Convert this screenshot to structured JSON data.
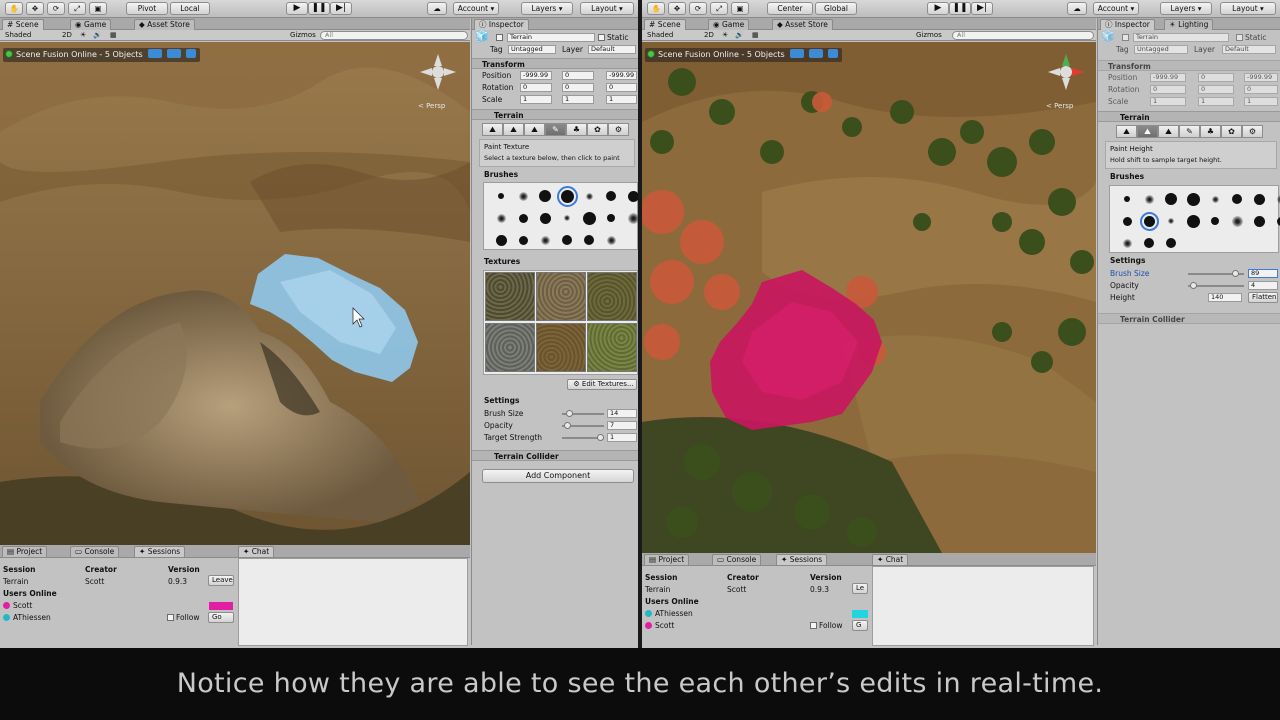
{
  "left": {
    "toolbar": {
      "pivot": "Pivot",
      "local": "Local",
      "account": "Account",
      "layers": "Layers",
      "layout": "Layout"
    },
    "tabs": {
      "scene": "Scene",
      "game": "Game",
      "asset_store": "Asset Store",
      "inspector": "Inspector"
    },
    "scene_bar": {
      "shaded": "Shaded",
      "mode_2d": "2D",
      "gizmos": "Gizmos",
      "search_placeholder": "All"
    },
    "banner": "Scene Fusion Online - 5 Objects",
    "persp": "< Persp",
    "inspector": {
      "object_name": "Terrain",
      "static": "Static",
      "tag_label": "Tag",
      "tag": "Untagged",
      "layer_label": "Layer",
      "layer": "Default",
      "transform": "Transform",
      "position": {
        "label": "Position",
        "x": "-999.99",
        "y": "0",
        "z": "-999.99"
      },
      "rotation": {
        "label": "Rotation",
        "x": "0",
        "y": "0",
        "z": "0"
      },
      "scale": {
        "label": "Scale",
        "x": "1",
        "y": "1",
        "z": "1"
      },
      "terrain": "Terrain",
      "tool_title": "Paint Texture",
      "tool_desc": "Select a texture below, then click to paint",
      "brushes": "Brushes",
      "textures": "Textures",
      "edit_textures": "Edit Textures...",
      "settings": "Settings",
      "brush_size": {
        "label": "Brush Size",
        "value": "14",
        "level": 0.12
      },
      "opacity": {
        "label": "Opacity",
        "value": "7",
        "level": 0.07
      },
      "target_strength": {
        "label": "Target Strength",
        "value": "1",
        "level": 1.0
      },
      "terrain_collider": "Terrain Collider",
      "add_component": "Add Component"
    },
    "bottom": {
      "tabs": {
        "project": "Project",
        "console": "Console",
        "sessions": "Sessions",
        "chat": "Chat"
      },
      "headers": {
        "session": "Session",
        "creator": "Creator",
        "version": "Version"
      },
      "session_row": {
        "session": "Terrain",
        "creator": "Scott",
        "version": "0.9.3",
        "leave": "Leave"
      },
      "users_online": "Users Online",
      "users": [
        {
          "name": "Scott",
          "color": "#e21ea3",
          "follow": "",
          "go": ""
        },
        {
          "name": "AThiessen",
          "color": "#22b8c8",
          "follow": "Follow",
          "go": "Go"
        }
      ]
    }
  },
  "right": {
    "toolbar": {
      "center": "Center",
      "global": "Global",
      "account": "Account",
      "layers": "Layers",
      "layout": "Layout"
    },
    "tabs": {
      "scene": "Scene",
      "game": "Game",
      "asset_store": "Asset Store",
      "inspector": "Inspector",
      "lighting": "Lighting"
    },
    "scene_bar": {
      "shaded": "Shaded",
      "mode_2d": "2D",
      "gizmos": "Gizmos",
      "search_placeholder": "All"
    },
    "banner": "Scene Fusion Online - 5 Objects",
    "persp": "< Persp",
    "inspector": {
      "object_name": "Terrain",
      "static": "Static",
      "tag_label": "Tag",
      "tag": "Untagged",
      "layer_label": "Layer",
      "layer": "Default",
      "transform": "Transform",
      "position": {
        "label": "Position",
        "x": "-999.99",
        "y": "0",
        "z": "-999.99"
      },
      "rotation": {
        "label": "Rotation",
        "x": "0",
        "y": "0",
        "z": "0"
      },
      "scale": {
        "label": "Scale",
        "x": "1",
        "y": "1",
        "z": "1"
      },
      "terrain": "Terrain",
      "tool_title": "Paint Height",
      "tool_desc": "Hold shift to sample target height.",
      "brushes": "Brushes",
      "settings": "Settings",
      "brush_size": {
        "label": "Brush Size",
        "value": "89",
        "level": 0.89
      },
      "opacity": {
        "label": "Opacity",
        "value": "4",
        "level": 0.04
      },
      "height": {
        "label": "Height",
        "value": "140",
        "flatten": "Flatten"
      },
      "terrain_collider": "Terrain Collider"
    },
    "bottom": {
      "tabs": {
        "project": "Project",
        "console": "Console",
        "sessions": "Sessions",
        "chat": "Chat"
      },
      "headers": {
        "session": "Session",
        "creator": "Creator",
        "version": "Version"
      },
      "session_row": {
        "session": "Terrain",
        "creator": "Scott",
        "version": "0.9.3",
        "leave": "Le"
      },
      "users_online": "Users Online",
      "users": [
        {
          "name": "AThiessen",
          "color": "#22b8c8",
          "follow": "",
          "go": ""
        },
        {
          "name": "Scott",
          "color": "#e21ea3",
          "follow": "Follow",
          "go": "G"
        }
      ]
    }
  },
  "caption": "Notice how they are able to see the each other’s edits in real-time."
}
